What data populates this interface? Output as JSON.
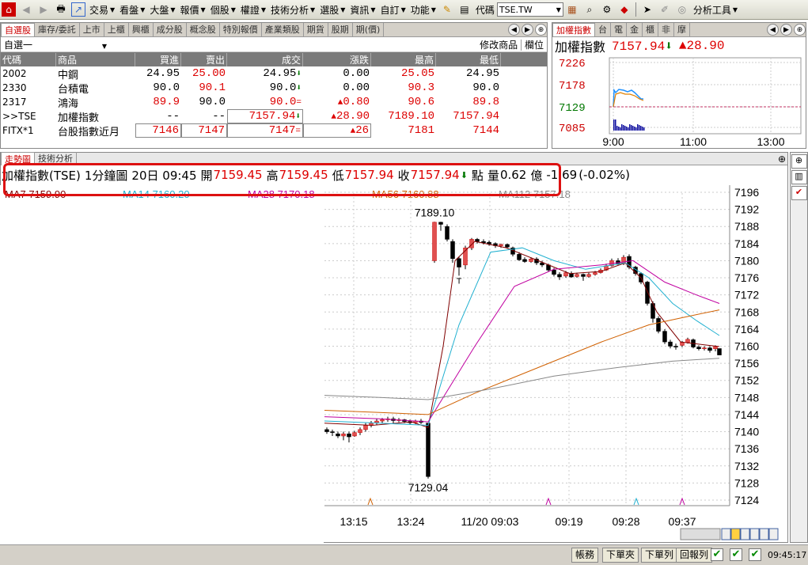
{
  "toolbar": {
    "menus": [
      "交易",
      "看盤",
      "大盤",
      "報價",
      "個股",
      "權證",
      "技術分析",
      "選股",
      "資訊",
      "自訂",
      "功能"
    ],
    "code_label": "代碼",
    "code_value": "TSE.TW",
    "analysis_tools": "分析工具"
  },
  "quote_panel": {
    "tabs": [
      "自選股",
      "庫存/委託",
      "上市",
      "上櫃",
      "興櫃",
      "成分股",
      "概念股",
      "特別報價",
      "產業類股",
      "期貨",
      "股期",
      "期(價)"
    ],
    "watchlist": "自選一",
    "modify_btn": "修改商品",
    "column_btn": "欄位",
    "headers": [
      "代碼",
      "商品",
      "買進",
      "賣出",
      "成交",
      "漲跌",
      "最高",
      "最低"
    ],
    "rows": [
      {
        "code": "2002",
        "name": "中鋼",
        "bid": "24.95",
        "ask": "25.00",
        "last": "24.95",
        "chg": "0.00",
        "high": "25.05",
        "low": "24.95"
      },
      {
        "code": "2330",
        "name": "台積電",
        "bid": "90.0",
        "ask": "90.1",
        "last": "90.0",
        "chg": "0.00",
        "high": "90.3",
        "low": "90.0"
      },
      {
        "code": "2317",
        "name": "鴻海",
        "bid": "89.9",
        "ask": "90.0",
        "last": "90.0",
        "chg": "0.80",
        "high": "90.6",
        "low": "89.8"
      },
      {
        "code": ">>TSE",
        "name": "加權指數",
        "bid": "--",
        "ask": "--",
        "last": "7157.94",
        "chg": "28.90",
        "high": "7189.10",
        "low": "7157.94"
      },
      {
        "code": "FITX*1",
        "name": "台股指數近月",
        "bid": "7146",
        "ask": "7147",
        "last": "7147",
        "chg": "26",
        "high": "7181",
        "low": "7144"
      }
    ]
  },
  "mini_panel": {
    "tabs": [
      "加權指數",
      "台",
      "電",
      "金",
      "櫃",
      "非",
      "摩"
    ],
    "title": "加權指數",
    "price": "7157.94",
    "change": "28.90",
    "y_ticks": [
      "7226",
      "7178",
      "7129",
      "7085"
    ],
    "x_ticks": [
      "9:00",
      "11:00",
      "13:00"
    ]
  },
  "chart_panel": {
    "tabs": [
      "走勢圖",
      "技術分析"
    ],
    "info": {
      "name": "加權指數(TSE)",
      "period": "1分鐘圖",
      "date": "20日 09:45",
      "open_label": "開",
      "open": "7159.45",
      "high_label": "高",
      "high": "7159.45",
      "low_label": "低",
      "low": "7157.94",
      "close_label": "收",
      "close": "7157.94",
      "unit": "點",
      "vol_label": "量",
      "vol": "0.62",
      "vol_unit": "億",
      "chg": "-1.69",
      "pct": "(-0.02%)"
    },
    "ma_labels": [
      "MA7 7159.90",
      "MA14 7160.20",
      "MA28 7170.18",
      "MA56 7160.88",
      "MA112 7157.18"
    ],
    "y_ticks": [
      "7196",
      "7192",
      "7188",
      "7184",
      "7180",
      "7176",
      "7172",
      "7168",
      "7164",
      "7160",
      "7156",
      "7152",
      "7148",
      "7144",
      "7140",
      "7136",
      "7132",
      "7128",
      "7124"
    ],
    "x_ticks": [
      "13:15",
      "13:24",
      "11/20 09:03",
      "09:19",
      "09:28",
      "09:37"
    ],
    "high_annot": "7189.10",
    "low_annot": "7129.04"
  },
  "status": {
    "buttons": [
      "帳務",
      "下單夾",
      "下單列",
      "回報列"
    ],
    "time": "09:45:17"
  },
  "colors": {
    "up": "#dd0000",
    "down": "#007700",
    "ma7": "#800000",
    "ma14": "#20b0d0",
    "ma28": "#c000a0",
    "ma56": "#d06000",
    "ma112": "#888888"
  }
}
